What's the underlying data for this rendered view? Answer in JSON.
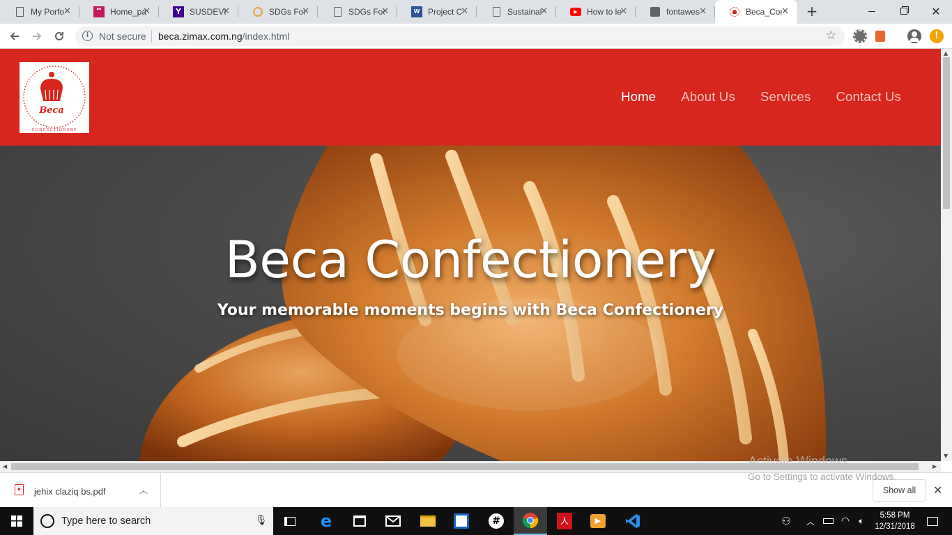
{
  "browser": {
    "tabs": [
      {
        "title": "My Porfo",
        "icon": "document-icon",
        "active": false
      },
      {
        "title": "Home_pa",
        "icon": "site-thumb-icon",
        "active": false
      },
      {
        "title": "SUSDEVI",
        "icon": "yahoo-icon",
        "active": false
      },
      {
        "title": "SDGs Foc",
        "icon": "sdg-icon",
        "active": false
      },
      {
        "title": "SDGs Foc",
        "icon": "document-icon",
        "active": false
      },
      {
        "title": "Project C",
        "icon": "word-icon",
        "active": false
      },
      {
        "title": "Sustainal",
        "icon": "document-icon",
        "active": false
      },
      {
        "title": "How to le",
        "icon": "youtube-icon",
        "active": false
      },
      {
        "title": "fontawes",
        "icon": "flag-icon",
        "active": false
      },
      {
        "title": "Beca_Cor",
        "icon": "beca-icon",
        "active": true
      }
    ],
    "security_label": "Not secure",
    "url_host": "beca.zimax.com.ng",
    "url_path": "/index.html"
  },
  "site": {
    "nav": [
      "Home",
      "About Us",
      "Services",
      "Contact Us"
    ],
    "logo_text": "Beca",
    "logo_subtext": "CONFECTIONERY",
    "hero_title": "Beca Confectionery",
    "hero_subtitle": "Your memorable moments begins with Beca Confectionery",
    "brand_color": "#d7261e"
  },
  "watermark": {
    "line1": "Activate Windows",
    "line2": "Go to Settings to activate Windows."
  },
  "downloads": {
    "file": "jehix claziq bs.pdf",
    "show_all": "Show all"
  },
  "taskbar": {
    "search_placeholder": "Type here to search",
    "time": "5:58 PM",
    "date": "12/31/2018"
  }
}
